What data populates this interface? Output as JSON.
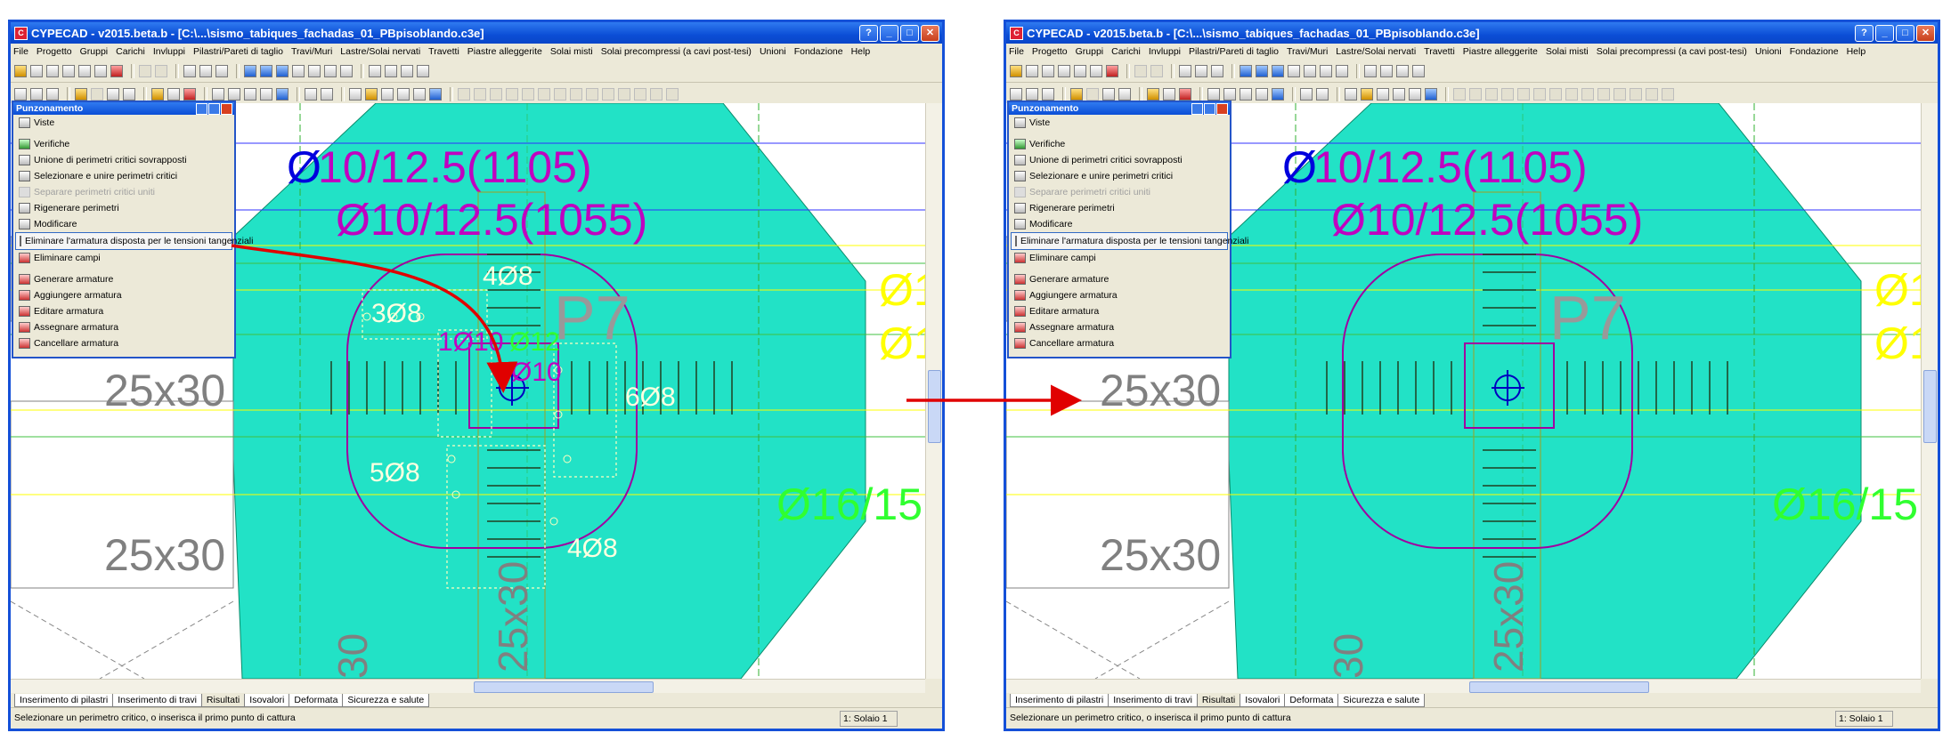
{
  "window": {
    "title": "CYPECAD - v2015.beta.b - [C:\\...\\sismo_tabiques_fachadas_01_PBpisoblando.c3e]",
    "help": "?",
    "minimize": "_",
    "maximize": "□",
    "close": "✕"
  },
  "menu": [
    "File",
    "Progetto",
    "Gruppi",
    "Carichi",
    "Invluppi",
    "Pilastri/Pareti di taglio",
    "Travi/Muri",
    "Lastre/Solai nervati",
    "Travetti",
    "Piastre alleggerite",
    "Solai misti",
    "Solai precompressi (a cavi post-tesi)",
    "Unioni",
    "Fondazione",
    "Help"
  ],
  "panel": {
    "title": "Punzonamento",
    "items": [
      {
        "label": "Viste",
        "enabled": true
      },
      {
        "label": "Verifiche",
        "enabled": true
      },
      {
        "label": "Unione di perimetri critici sovrapposti",
        "enabled": true
      },
      {
        "label": "Selezionare e unire perimetri critici",
        "enabled": true
      },
      {
        "label": "Separare perimetri critici uniti",
        "enabled": false
      },
      {
        "label": "Rigenerare perimetri",
        "enabled": true
      },
      {
        "label": "Modificare",
        "enabled": true
      },
      {
        "label": "Eliminare l'armatura disposta per le tensioni tangenziali",
        "enabled": true
      },
      {
        "label": "Eliminare campi",
        "enabled": true
      },
      {
        "label": "Generare armature",
        "enabled": true
      },
      {
        "label": "Aggiungere armatura",
        "enabled": true
      },
      {
        "label": "Editare armatura",
        "enabled": true
      },
      {
        "label": "Assegnare armatura",
        "enabled": true
      },
      {
        "label": "Cancellare armatura",
        "enabled": true
      }
    ]
  },
  "drawing": {
    "rebar_top": "Ø10/12.5(1105)",
    "rebar_mid": "Ø10/12.5(1055)",
    "column_label": "P7",
    "beam_label_1": "25x30",
    "beam_label_2": "25x30",
    "beam_vertical_label": "25x30",
    "beam_vertical_label_left": "30",
    "rebar_right_1": "Ø1",
    "rebar_right_2": "Ø1",
    "rebar_right_3": "Ø16/15",
    "before_labels": {
      "l1": "4Ø8",
      "l2": "3Ø8",
      "l3": "1Ø10",
      "l4": "Ø12",
      "l5": "Ø10",
      "l6": "6Ø8",
      "l7": "5Ø8",
      "l8": "4Ø8"
    }
  },
  "tabs": [
    "Inserimento di pilastri",
    "Inserimento di travi",
    "Risultati",
    "Isovalori",
    "Deformata",
    "Sicurezza e salute"
  ],
  "active_tab": "Risultati",
  "status": {
    "message": "Selezionare un perimetro critico, o inserisca il primo punto di cattura",
    "solaio": "1: Solaio 1"
  },
  "colors": {
    "slab": "#22e2c6",
    "magenta": "#c000c0",
    "blue": "#0000dd",
    "arrow": "#e00000",
    "grey_label": "#808080",
    "yellow": "#ffff00",
    "green": "#00ff00"
  }
}
